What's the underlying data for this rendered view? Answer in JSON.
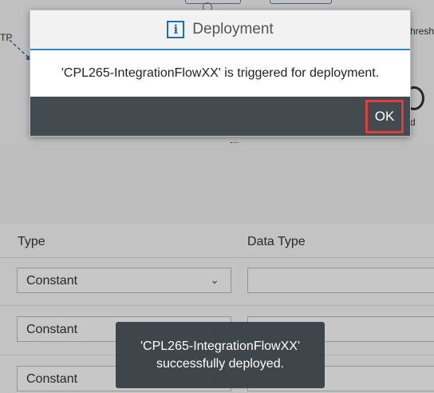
{
  "background": {
    "diagram": {
      "fragment_left": "TP",
      "fragment_right": "hresh",
      "fragment_bottom_right": "d"
    },
    "table": {
      "columns": [
        "Type",
        "Data Type"
      ],
      "rows": [
        {
          "type": "Constant",
          "data_type": ""
        },
        {
          "type": "Constant",
          "data_type": ""
        },
        {
          "type": "Constant",
          "data_type": ""
        }
      ]
    }
  },
  "dialog": {
    "title": "Deployment",
    "icon": "info-icon",
    "message": "'CPL265-IntegrationFlowXX' is triggered for deployment.",
    "ok_label": "OK",
    "accent_color": "#2f87c6",
    "highlight_color": "#e03c3c"
  },
  "toast": {
    "line1": "'CPL265-IntegrationFlowXX'",
    "line2": "successfully deployed."
  }
}
